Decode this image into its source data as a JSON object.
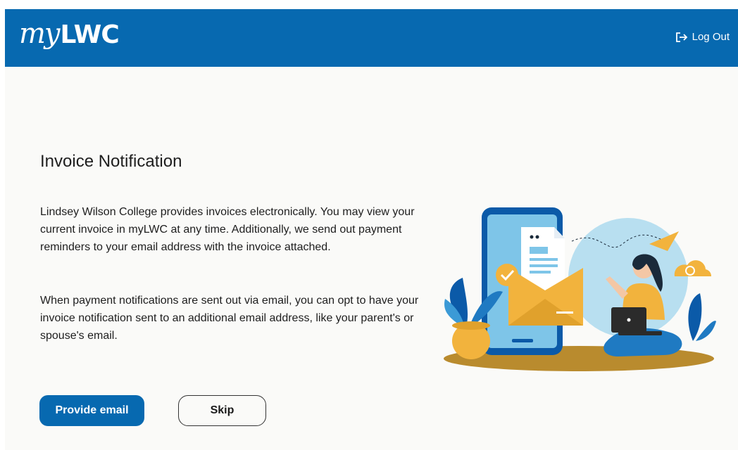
{
  "header": {
    "logo_prefix": "my",
    "logo_suffix": "LWC",
    "logout_label": "Log Out"
  },
  "main": {
    "title": "Invoice Notification",
    "paragraph_1": "Lindsey Wilson College provides invoices electronically. You may view your current invoice in myLWC at any time. Additionally, we send out payment reminders to your email address with the invoice attached.",
    "paragraph_2": "When payment notifications are sent out via email, you can opt to have your invoice notification sent to an additional email address, like your parent's or spouse's email.",
    "provide_email_label": "Provide email",
    "skip_label": "Skip"
  },
  "colors": {
    "brand_blue": "#0769b0",
    "accent_yellow": "#f2b33d",
    "background": "#fafaf8"
  },
  "icons": {
    "logout": "logout-icon",
    "illustration": "invoice-email-illustration"
  }
}
